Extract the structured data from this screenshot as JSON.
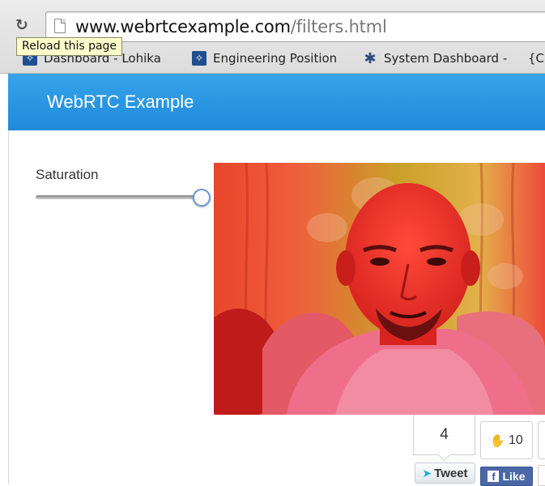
{
  "browser": {
    "url_host": "www.webrtcexample.com",
    "url_path": "/filters.html",
    "reload_tooltip": "Reload this page",
    "bookmarks": [
      {
        "label": "Dashboard - Lohika",
        "icon": "jira-icon"
      },
      {
        "label": "Engineering Position",
        "icon": "jira-icon"
      },
      {
        "label": "System Dashboard -",
        "icon": "person-star-icon"
      },
      {
        "label": "{C",
        "icon": null
      }
    ]
  },
  "navbar": {
    "brand": "WebRTC Example",
    "color": "#2b97e2"
  },
  "controls": {
    "saturation_label": "Saturation",
    "saturation_level": 1.0
  },
  "video": {
    "description_icon": "webcam-video",
    "tint": "#ff2a2a"
  },
  "social": {
    "tweet_count": "4",
    "tweet_label": "Tweet",
    "like_count": "10",
    "like_label": "Like"
  }
}
